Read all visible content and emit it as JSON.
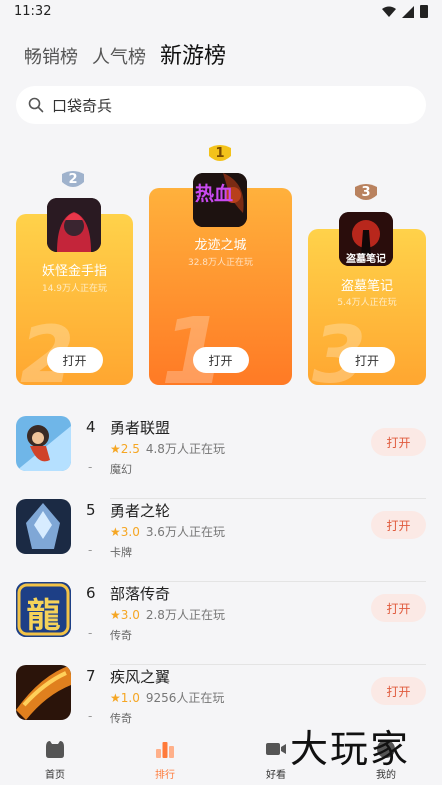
{
  "status": {
    "time": "11:32"
  },
  "tabs": [
    {
      "label": "畅销榜"
    },
    {
      "label": "人气榜"
    },
    {
      "label": "新游榜"
    }
  ],
  "search": {
    "text": "口袋奇兵"
  },
  "podium": [
    {
      "rank": "2",
      "name": "妖怪金手指",
      "players": "14.9万人正在玩",
      "button": "打开",
      "big_num": "2"
    },
    {
      "rank": "1",
      "name": "龙迹之城",
      "players": "32.8万人正在玩",
      "button": "打开",
      "big_num": "1",
      "icon_text": "热血"
    },
    {
      "rank": "3",
      "name": "盗墓笔记",
      "players": "5.4万人正在玩",
      "button": "打开",
      "big_num": "3",
      "icon_text": "盗墓笔记"
    }
  ],
  "list": [
    {
      "rank": "4",
      "name": "勇者联盟",
      "score": "2.5",
      "players": "4.8万人正在玩",
      "tag": "魔幻",
      "dash": "-",
      "button": "打开"
    },
    {
      "rank": "5",
      "name": "勇者之轮",
      "score": "3.0",
      "players": "3.6万人正在玩",
      "tag": "卡牌",
      "dash": "-",
      "button": "打开"
    },
    {
      "rank": "6",
      "name": "部落传奇",
      "score": "3.0",
      "players": "2.8万人正在玩",
      "tag": "传奇",
      "dash": "-",
      "button": "打开",
      "icon_text": "龍"
    },
    {
      "rank": "7",
      "name": "疾风之翼",
      "score": "1.0",
      "players": "9256人正在玩",
      "tag": "传奇",
      "dash": "-",
      "button": "打开"
    }
  ],
  "nav": [
    {
      "label": "首页",
      "icon": "home-icon"
    },
    {
      "label": "排行",
      "icon": "ranking-icon"
    },
    {
      "label": "好看",
      "icon": "video-icon"
    },
    {
      "label": "我的",
      "icon": "profile-icon"
    }
  ],
  "watermark": "大玩家",
  "colors": {
    "accent": "#ff7a3a",
    "podium_gold": "#ffa630",
    "open_button_bg": "#fbe9e5",
    "open_button_text": "#e05a3c"
  }
}
